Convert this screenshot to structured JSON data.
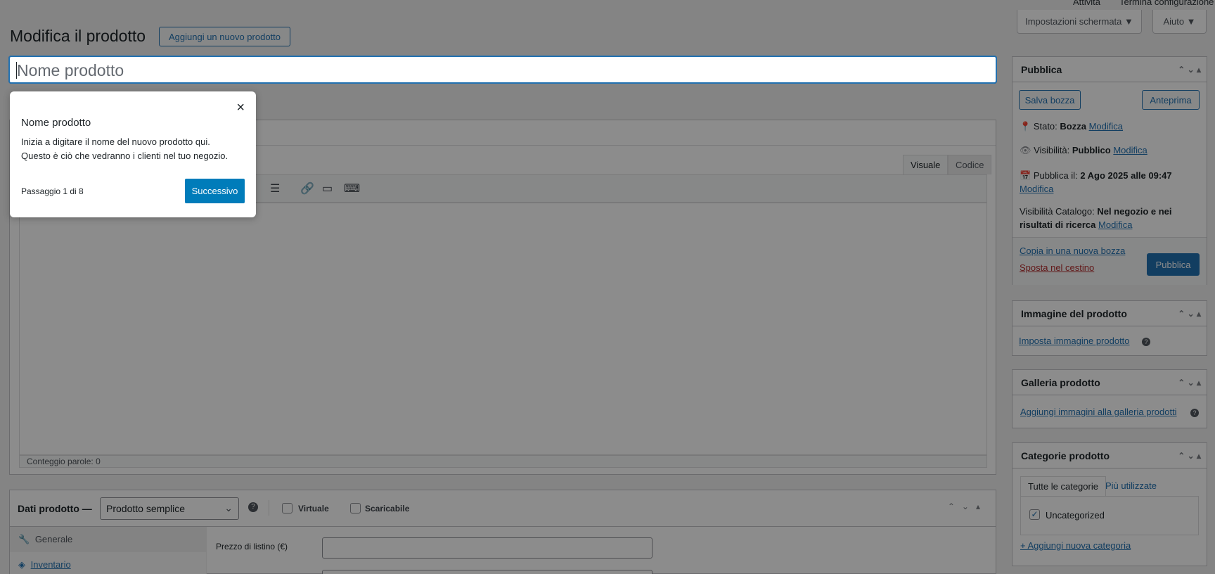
{
  "topbar": {
    "activity": "Attività",
    "finish_setup": "Termina configurazione"
  },
  "screen_options": {
    "label": "Impostazioni schermata ▼"
  },
  "help": {
    "label": "Aiuto ▼"
  },
  "page": {
    "title": "Modifica il prodotto",
    "add_new": "Aggiungi un nuovo prodotto"
  },
  "title_field": {
    "placeholder": "Nome prodotto"
  },
  "editor": {
    "tab_visual": "Visuale",
    "tab_code": "Codice",
    "word_count": "Conteggio parole: 0"
  },
  "tour": {
    "title": "Nome prodotto",
    "body_line1": "Inizia a digitare il nome del nuovo prodotto qui.",
    "body_line2": "Questo è ciò che vedranno i clienti nel tuo negozio.",
    "step": "Passaggio 1 di 8",
    "next": "Successivo",
    "close": "×"
  },
  "product_data": {
    "label": "Dati prodotto —",
    "type_selected": "Prodotto semplice",
    "virtual": "Virtuale",
    "downloadable": "Scaricabile",
    "tabs": [
      {
        "label": "Generale",
        "icon": "wrench-icon"
      },
      {
        "label": "Inventario",
        "icon": "tag-icon"
      }
    ],
    "regular_price_label": "Prezzo di listino (€)"
  },
  "publish": {
    "title": "Pubblica",
    "save_draft": "Salva bozza",
    "preview": "Anteprima",
    "status_label": "Stato:",
    "status_value": "Bozza",
    "visibility_label": "Visibilità:",
    "visibility_value": "Pubblico",
    "publish_label": "Pubblica il:",
    "publish_value": "2 Ago 2025 alle 09:47",
    "edit": "Modifica",
    "catalog_label": "Visibilità Catalogo:",
    "catalog_value_1": "Nel negozio e nei",
    "catalog_value_2": "risultati di ricerca",
    "copy_draft": "Copia in una nuova bozza",
    "trash": "Sposta nel cestino",
    "publish_button": "Pubblica"
  },
  "product_image": {
    "title": "Immagine del prodotto",
    "link": "Imposta immagine prodotto"
  },
  "gallery": {
    "title": "Galleria prodotto",
    "link": "Aggiungi immagini alla galleria prodotti"
  },
  "categories": {
    "title": "Categorie prodotto",
    "tab_all": "Tutte le categorie",
    "tab_most_used": "Più utilizzate",
    "items": [
      {
        "label": "Uncategorized",
        "checked": true
      }
    ],
    "add_new": "+ Aggiungi nuova categoria"
  },
  "colors": {
    "primary": "#2271b1",
    "tour_button": "#007cba",
    "trash": "#b32d2e"
  }
}
